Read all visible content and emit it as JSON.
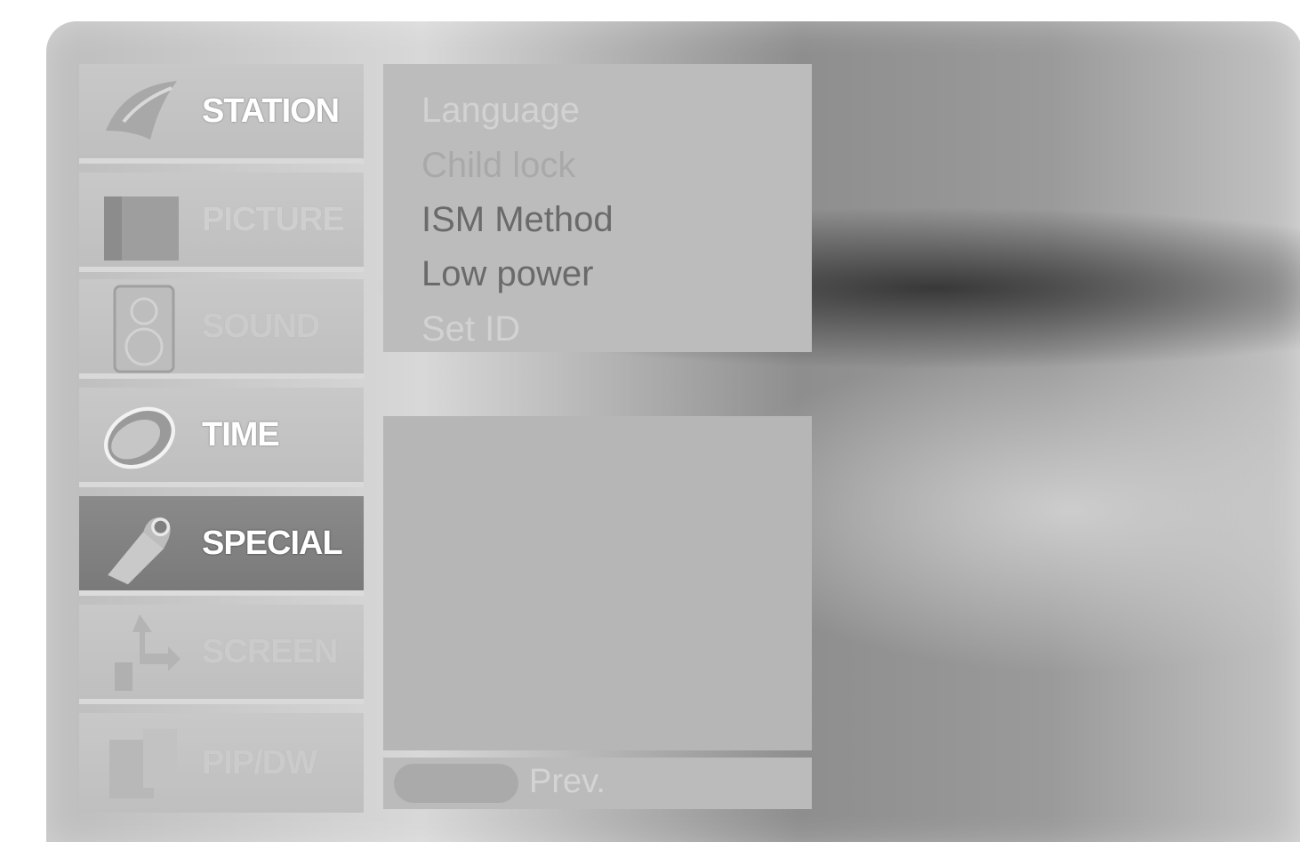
{
  "colors": {
    "panel": "#bcbcbc",
    "active_tab": "#7f7f7f",
    "text_active": "#ffffff",
    "text_selected": "#6a6a6a",
    "text_dim": "#d2d2d2"
  },
  "sidebar": {
    "items": [
      {
        "label": "STATION",
        "icon": "satellite-dish-icon",
        "state": "bright"
      },
      {
        "label": "PICTURE",
        "icon": "picture-frame-icon",
        "state": "normal"
      },
      {
        "label": "SOUND",
        "icon": "speaker-icon",
        "state": "dim"
      },
      {
        "label": "TIME",
        "icon": "clock-icon",
        "state": "bright"
      },
      {
        "label": "SPECIAL",
        "icon": "tag-icon",
        "state": "active"
      },
      {
        "label": "SCREEN",
        "icon": "arrows-icon",
        "state": "dim"
      },
      {
        "label": "PIP/DW",
        "icon": "pip-windows-icon",
        "state": "dim"
      }
    ]
  },
  "menu": {
    "items": [
      {
        "label": "Language"
      },
      {
        "label": "Child lock"
      },
      {
        "label": "ISM Method"
      },
      {
        "label": "Low power"
      },
      {
        "label": "Set ID"
      }
    ]
  },
  "footer": {
    "prev_label": "Prev."
  }
}
